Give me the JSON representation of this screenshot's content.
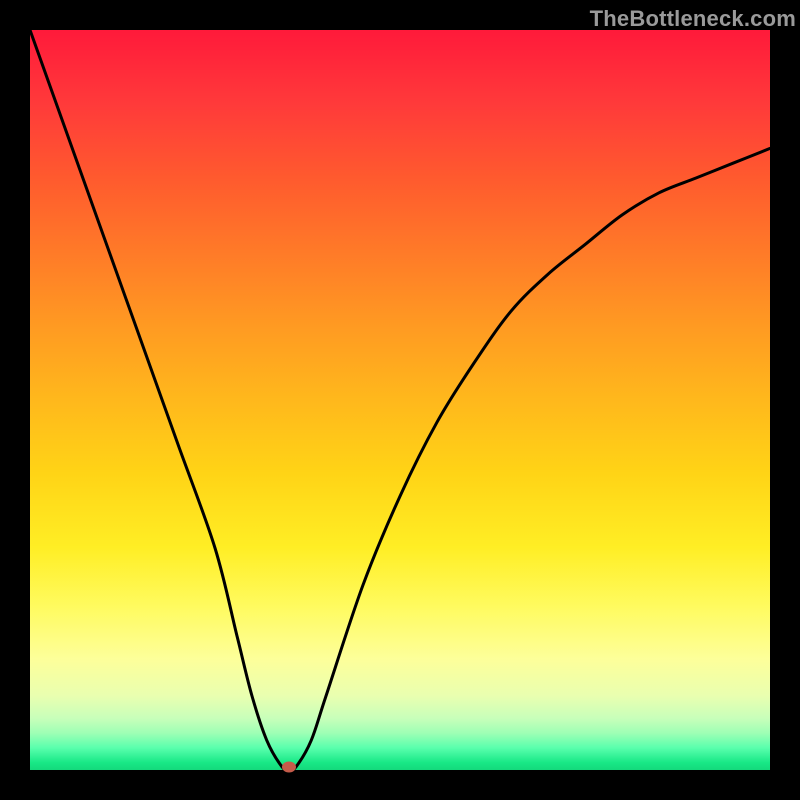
{
  "watermark": "TheBottleneck.com",
  "chart_data": {
    "type": "line",
    "title": "",
    "xlabel": "",
    "ylabel": "",
    "xlim": [
      0,
      100
    ],
    "ylim": [
      0,
      100
    ],
    "series": [
      {
        "name": "bottleneck-curve",
        "x": [
          0,
          5,
          10,
          15,
          20,
          25,
          28,
          30,
          32,
          34,
          35,
          36,
          38,
          40,
          45,
          50,
          55,
          60,
          65,
          70,
          75,
          80,
          85,
          90,
          95,
          100
        ],
        "y": [
          100,
          86,
          72,
          58,
          44,
          30,
          18,
          10,
          4,
          0.5,
          0,
          0.5,
          4,
          10,
          25,
          37,
          47,
          55,
          62,
          67,
          71,
          75,
          78,
          80,
          82,
          84
        ]
      }
    ],
    "marker": {
      "x": 35,
      "y": 0,
      "color": "#c55b4a",
      "radius": 6
    },
    "colors": {
      "curve": "#000000",
      "gradient_top": "#ff1a3a",
      "gradient_bottom": "#14d97c",
      "frame": "#000000"
    }
  }
}
